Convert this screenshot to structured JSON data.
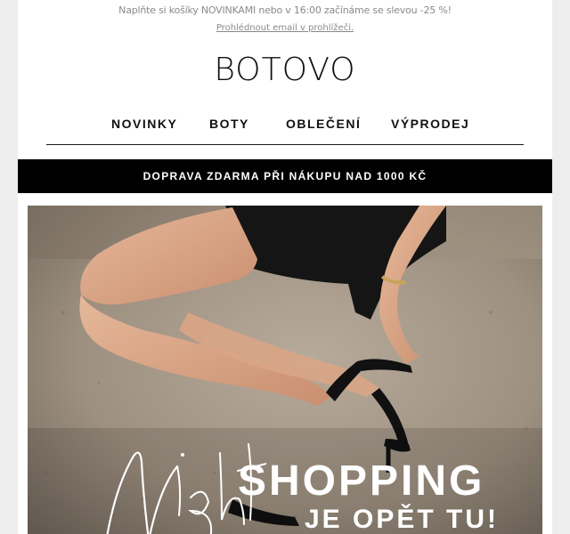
{
  "preheader": {
    "text": "Naplňte si košíky NOVINKAMI nebo v 16:00 začínáme se slevou -25 %!",
    "view_in_browser": "Prohlédnout email v prohlížeči."
  },
  "header": {
    "logo": "BOTOVO"
  },
  "nav": {
    "items": [
      {
        "label": "NOVINKY"
      },
      {
        "label": "BOTY"
      },
      {
        "label": "OBLEČENÍ"
      },
      {
        "label": "VÝPRODEJ"
      }
    ]
  },
  "banner": {
    "text": "DOPRAVA ZDARMA PŘI NÁKUPU NAD 1000 KČ"
  },
  "hero": {
    "script_word": "Night",
    "title": "SHOPPING",
    "subtitle": "JE OPĚT TU!"
  },
  "colors": {
    "background": "#ededed",
    "email_bg": "#ffffff",
    "banner_bg": "#000000",
    "text_dark": "#111111",
    "text_muted": "#8a8a8a"
  }
}
